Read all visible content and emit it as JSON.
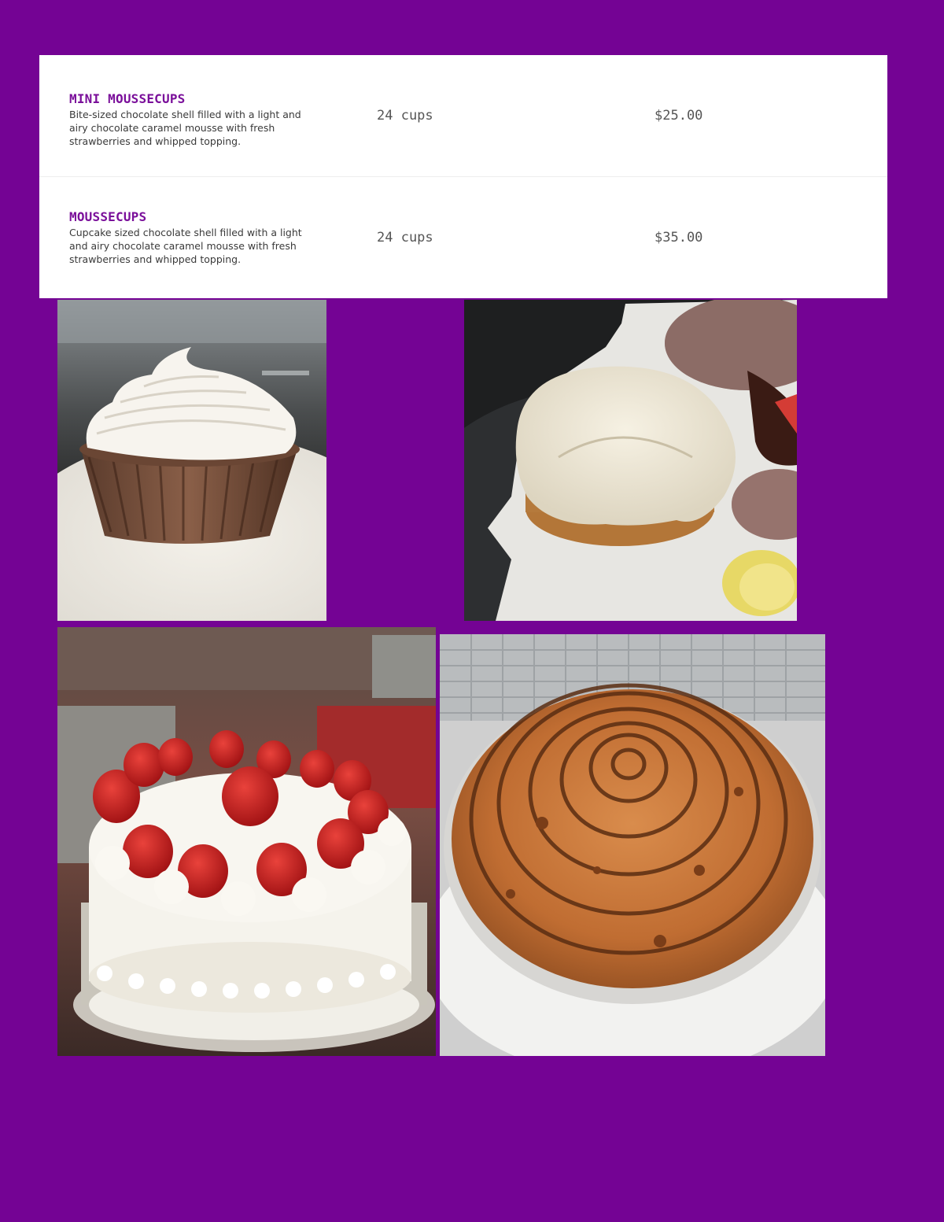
{
  "menu": {
    "items": [
      {
        "name": "MINI MOUSSECUPS",
        "description": "Bite-sized chocolate shell filled with a light and airy chocolate caramel mousse with fresh strawberries and whipped topping.",
        "quantity": "24 cups",
        "price": "$25.00"
      },
      {
        "name": "MOUSSECUPS",
        "description": "Cupcake sized chocolate shell filled with a light and airy chocolate caramel mousse with fresh strawberries and whipped topping.",
        "quantity": "24 cups",
        "price": "$35.00"
      }
    ]
  },
  "colors": {
    "page_background": "#740394",
    "item_name": "#7a0f9a",
    "card_background": "#ffffff"
  },
  "photos": [
    {
      "subject": "chocolate-cup-whipped-topping-photo"
    },
    {
      "subject": "iced-cinnamon-bun-photo"
    },
    {
      "subject": "strawberry-cream-cake-photo"
    },
    {
      "subject": "crumb-pie-chocolate-drizzle-photo"
    }
  ]
}
